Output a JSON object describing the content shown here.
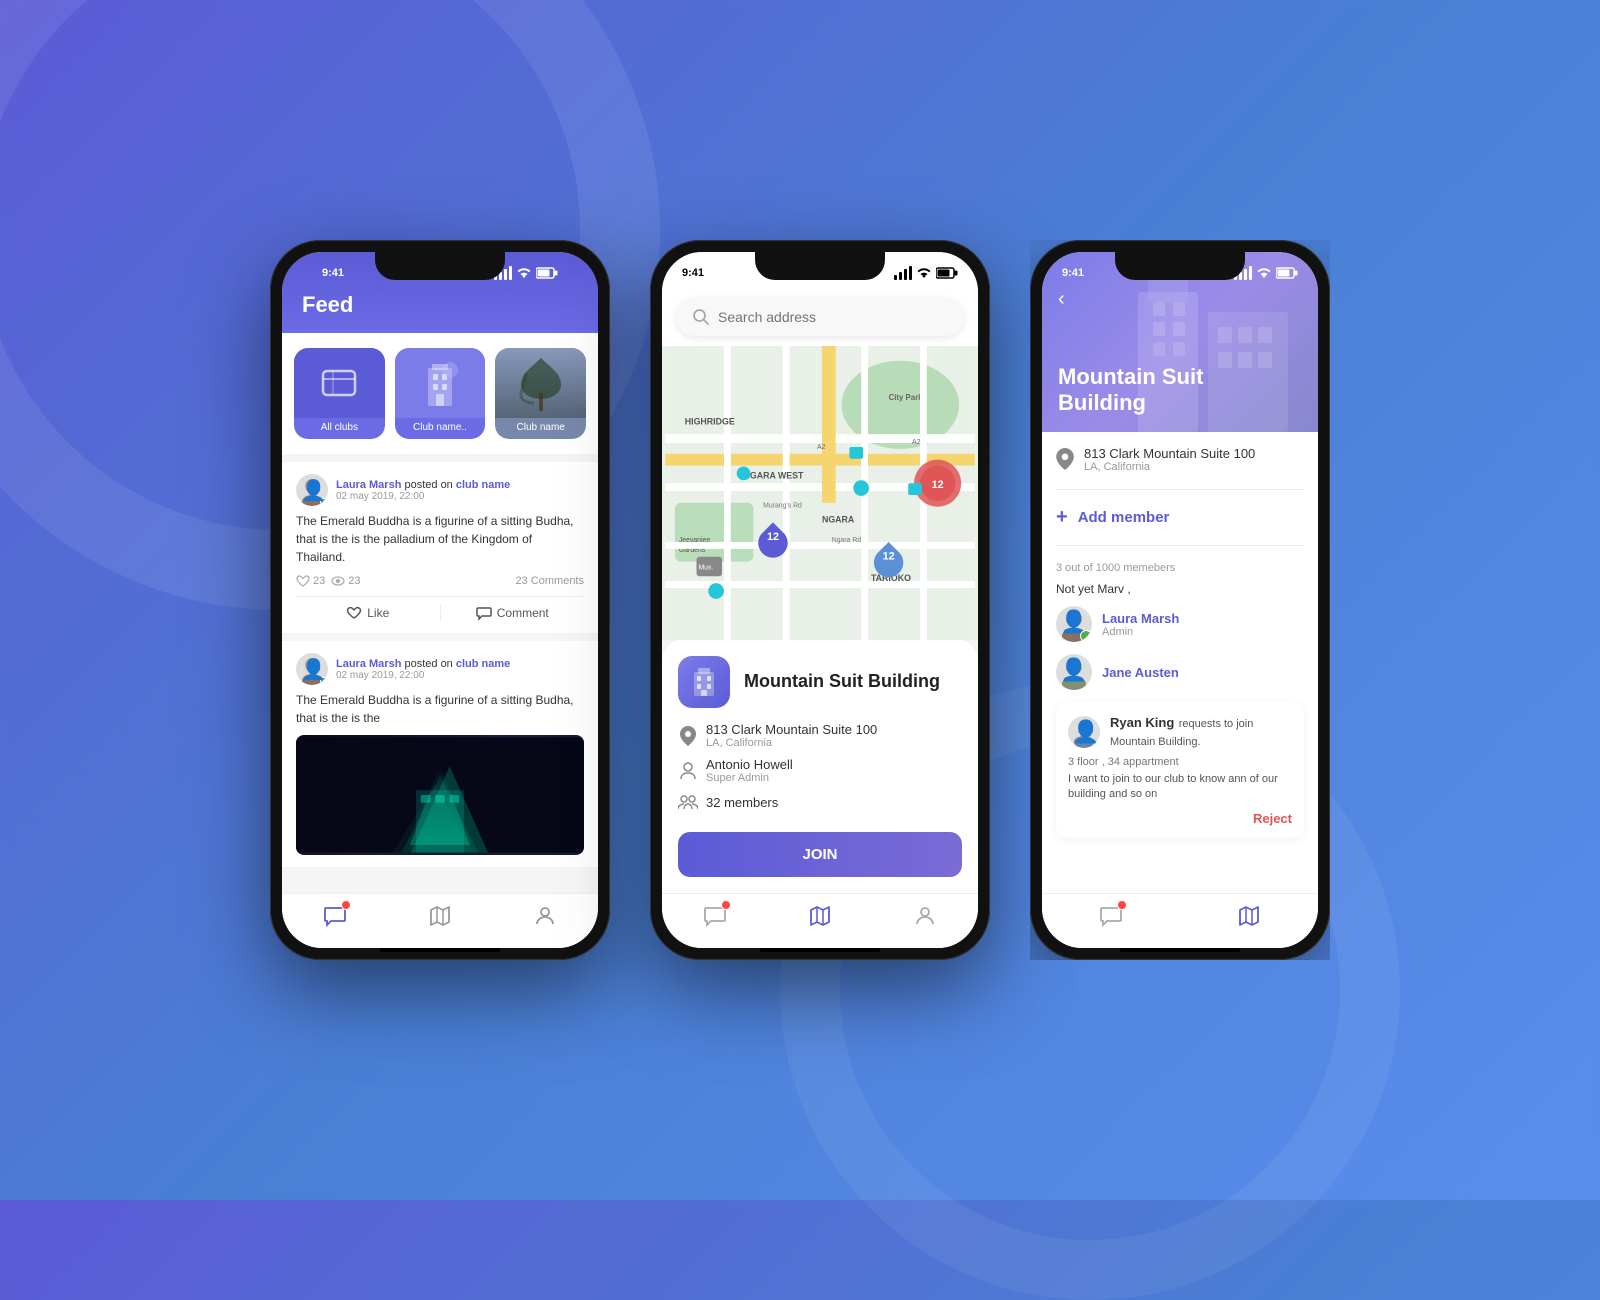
{
  "background": {
    "gradient_start": "#5b5bd6",
    "gradient_end": "#4a7fd4"
  },
  "phone1": {
    "status_time": "9:41",
    "header_title": "Feed",
    "clubs": [
      {
        "label": "All clubs",
        "type": "all"
      },
      {
        "label": "Club name..",
        "type": "building"
      },
      {
        "label": "Club name",
        "type": "nature"
      }
    ],
    "posts": [
      {
        "author": "Laura Marsh",
        "action": "posted on",
        "club": "club name",
        "time": "02 may 2019, 22:00",
        "text": "The Emerald Buddha is a figurine of a sitting Budha, that is the is the palladium of the Kingdom of Thailand.",
        "likes": "23",
        "views": "23",
        "comments": "23 Comments",
        "like_label": "Like",
        "comment_label": "Comment"
      },
      {
        "author": "Laura Marsh",
        "action": "posted on",
        "club": "club name",
        "time": "02 may 2019, 22:00",
        "text": "The Emerald Buddha is a figurine of a sitting Budha, that is the is the",
        "has_image": true
      }
    ],
    "nav": [
      "feed",
      "map",
      "profile"
    ]
  },
  "phone2": {
    "status_time": "9:41",
    "search_placeholder": "Search address",
    "location": {
      "name": "Mountain Suit Building",
      "address_line1": "813 Clark Mountain Suite 100",
      "address_line2": "LA, California",
      "admin_name": "Antonio Howell",
      "admin_role": "Super Admin",
      "members_count": "32 members",
      "join_label": "JOIN"
    },
    "map_labels": [
      "HIGHRIDGE",
      "City Park",
      "NGARA WEST",
      "NGARA",
      "TARIOKO",
      "Jeevanjee",
      "Gardens",
      "Murang's Rd",
      "Ngara Rd"
    ],
    "pins": [
      {
        "count": "12",
        "type": "blue"
      },
      {
        "count": "12",
        "type": "blue-2"
      },
      {
        "count": "12",
        "type": "red"
      }
    ]
  },
  "phone3": {
    "status_time": "9:41",
    "back_icon": "‹",
    "title": "Mountain Suit Building",
    "address_line1": "813 Clark Mountain Suite 100",
    "address_line2": "LA, California",
    "add_member_label": "Add member",
    "members_count_label": "3 out of 1000 memebers",
    "not_yet_label": "Not yet Marv ,",
    "members": [
      {
        "name": "Laura Marsh",
        "role": "Admin",
        "online": true
      },
      {
        "name": "Jane Austen",
        "role": "",
        "online": false
      }
    ],
    "request": {
      "requester": "Ryan King",
      "action_text": "requests to join Mountain Building.",
      "floor": "3 floor",
      "apartment": "34 appartment",
      "message": "I want to join to our club to know ann of our building and so on",
      "reject_label": "Reject"
    },
    "nav": [
      "feed",
      "map"
    ]
  }
}
